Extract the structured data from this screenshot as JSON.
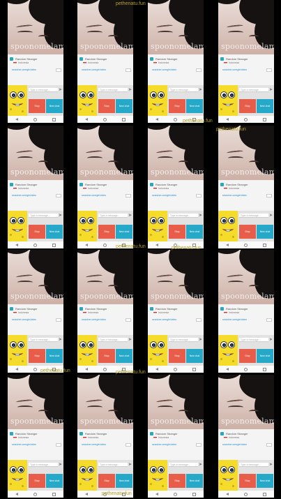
{
  "watermark_site": "pethenatu.fun",
  "tiles": {
    "video_watermark": "spoonomelami",
    "username": "Random Stranger",
    "country": "Indonesia",
    "link_text": "searcher.omegle/video",
    "input_placeholder": "Type a message...",
    "send_icon": "send-arrow-icon",
    "stop_label": "Stop",
    "next_label": "New chat"
  },
  "site_labels": [
    {
      "text": "pethenatu.fun"
    },
    {
      "text": "pethenatu.fun"
    },
    {
      "text": "pethenatu.fun"
    },
    {
      "text": "pethenatu.fun"
    },
    {
      "text": "pethenatu.fun"
    },
    {
      "text": "pethenatu.fun"
    },
    {
      "text": "pethenatu.fun"
    },
    {
      "text": "pethenatu.fun"
    }
  ],
  "colors": {
    "background": "#000000",
    "stop_button": "#e85c4a",
    "next_button": "#26a9c8",
    "sponge_yellow": "#f6dc2a",
    "link": "#1e8fd6",
    "site_watermark": "#b7a222"
  }
}
